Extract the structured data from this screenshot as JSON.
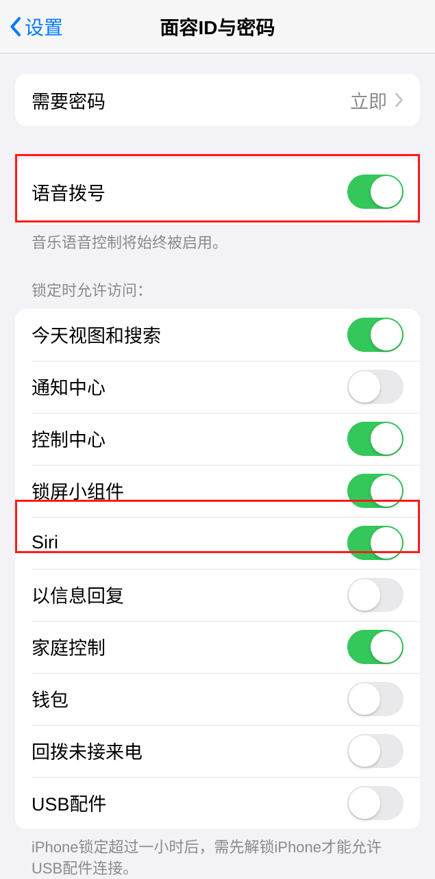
{
  "nav": {
    "back_label": "设置",
    "title": "面容ID与密码"
  },
  "require_passcode": {
    "label": "需要密码",
    "value": "立即"
  },
  "voice_dial": {
    "label": "语音拨号",
    "footer": "音乐语音控制将始终被启用。"
  },
  "lock_access": {
    "header": "锁定时允许访问：",
    "items": [
      {
        "label": "今天视图和搜索",
        "on": true
      },
      {
        "label": "通知中心",
        "on": false
      },
      {
        "label": "控制中心",
        "on": true
      },
      {
        "label": "锁屏小组件",
        "on": true
      },
      {
        "label": "Siri",
        "on": true
      },
      {
        "label": "以信息回复",
        "on": false
      },
      {
        "label": "家庭控制",
        "on": true
      },
      {
        "label": "钱包",
        "on": false
      },
      {
        "label": "回拨未接来电",
        "on": false
      },
      {
        "label": "USB配件",
        "on": false
      }
    ],
    "footer": "iPhone锁定超过一小时后，需先解锁iPhone才能允许USB配件连接。"
  }
}
